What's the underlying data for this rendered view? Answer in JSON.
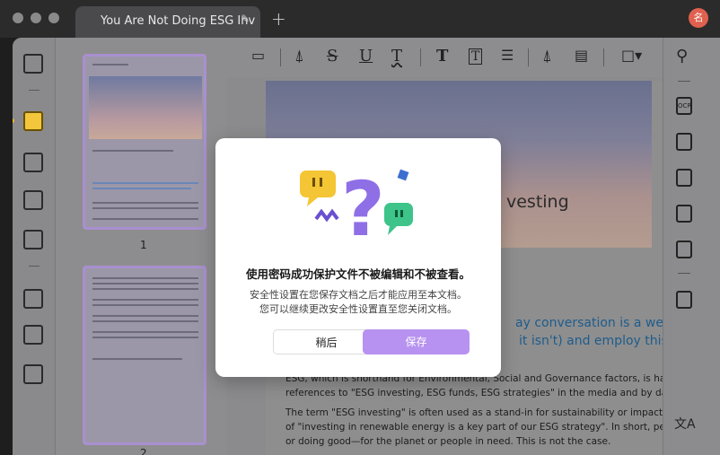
{
  "titlebar": {
    "tab_title": "You Are Not Doing ESG Inv",
    "edit_icon": "pencil-icon",
    "new_tab_icon": "plus-icon",
    "avatar_text": "名"
  },
  "thumbnails": {
    "page1_label": "1",
    "page2_label": "2"
  },
  "toolbar": {
    "items": [
      "comment-icon",
      "highlighter-icon",
      "strikethrough-icon",
      "underline-icon",
      "squiggly-icon",
      "text-icon",
      "textbox-icon",
      "callout-icon",
      "pencil-icon",
      "eraser-icon",
      "shape-icon"
    ],
    "strike_glyph": "S",
    "underline_glyph": "U",
    "squiggly_glyph": "T",
    "text_glyph": "T",
    "textbox_glyph": "T",
    "search_icon": "search-icon"
  },
  "document": {
    "heading_fragment": "vesting",
    "blue_line1": "ay conversation is a welc",
    "blue_line2": "it isn't) and employ this",
    "para1_line1": "ESG, which is shorthand for Environmental, Social and Governance factors, is having a m",
    "para1_line2": "references to \"ESG investing, ESG funds, ESG strategies\" in the media and by data provid",
    "para2_line1": "The term \"ESG investing\" is often used as a stand-in for sustainability or impact investi",
    "para2_line2": "of \"investing in renewable energy is a key part of our ESG strategy\". In short, people assu",
    "para2_line3": "or doing good—for the planet or people in need. This is not the case."
  },
  "rightbar": {
    "ocr_label": "OCR",
    "translate_label": "文A"
  },
  "modal": {
    "title": "使用密码成功保护文件不被编辑和不被查看。",
    "desc_line1": "安全性设置在您保存文档之后才能应用至本文档。",
    "desc_line2": "您可以继续更改安全性设置直至您关闭文档。",
    "cancel_label": "稍后",
    "save_label": "保存"
  },
  "colors": {
    "accent": "#b792f0",
    "active_tool": "#f4c63c",
    "link_blue": "#1e5c8c"
  }
}
